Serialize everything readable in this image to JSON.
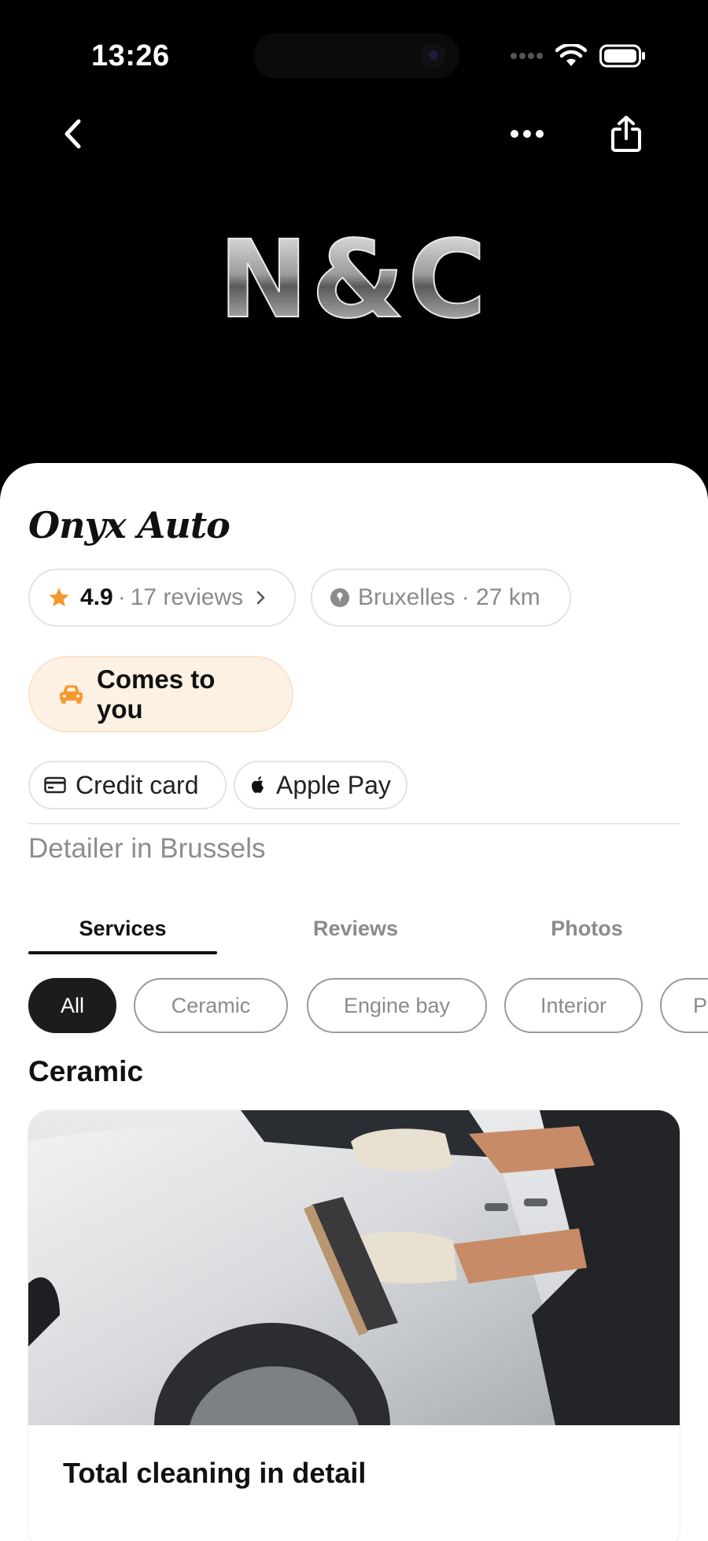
{
  "status_bar": {
    "time": "13:26"
  },
  "hero": {
    "logo_text": "N&C"
  },
  "business": {
    "name": "Onyx Auto",
    "rating": "4.9",
    "reviews_label": "17 reviews",
    "location": "Bruxelles · 27 km",
    "badge": "Comes to you",
    "payments": [
      "Credit card",
      "Apple Pay"
    ],
    "category": "Detailer in Brussels"
  },
  "tabs": [
    {
      "label": "Services",
      "active": true
    },
    {
      "label": "Reviews",
      "active": false
    },
    {
      "label": "Photos",
      "active": false
    }
  ],
  "filters": [
    {
      "label": "All",
      "active": true
    },
    {
      "label": "Ceramic",
      "active": false
    },
    {
      "label": "Engine bay",
      "active": false
    },
    {
      "label": "Interior",
      "active": false
    },
    {
      "label": "Pa",
      "active": false
    }
  ],
  "section": {
    "title": "Ceramic",
    "card_title": "Total cleaning in detail"
  },
  "colors": {
    "accent_orange": "#F39A2E",
    "badge_bg": "#FDF1E4",
    "dark": "#1C1C1C",
    "muted_text": "#8B8B8B"
  },
  "icons": {
    "back": "chevron-left-icon",
    "more": "more-dots-icon",
    "share": "share-icon",
    "star": "star-icon",
    "pin": "location-pin-icon",
    "car": "car-icon",
    "card": "credit-card-icon",
    "apple": "apple-icon"
  }
}
